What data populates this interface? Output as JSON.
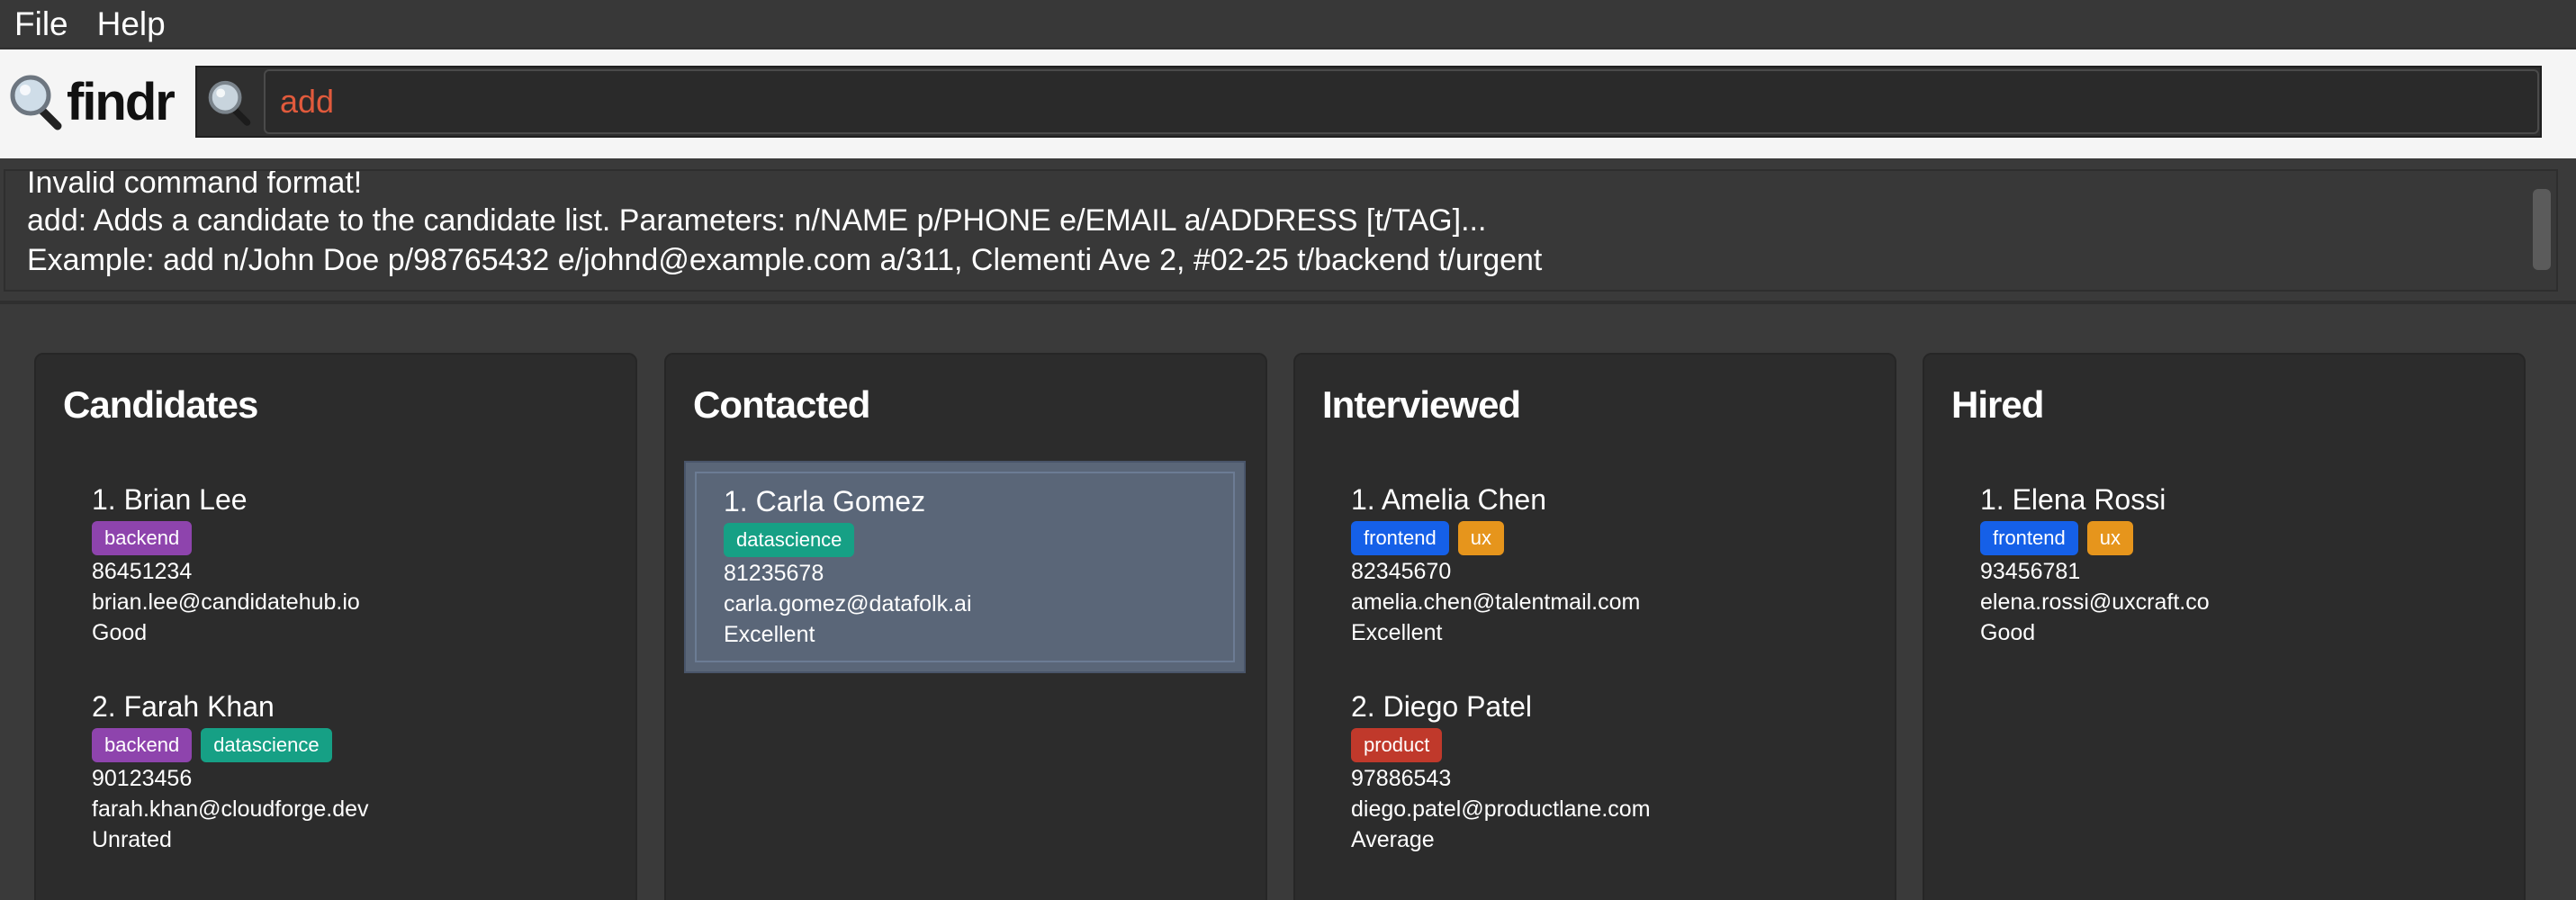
{
  "menu": {
    "file": "File",
    "help": "Help"
  },
  "header": {
    "logo_text": "findr"
  },
  "search": {
    "value": "add"
  },
  "result": {
    "lines": [
      "Invalid command format!",
      "add: Adds a candidate to the candidate list. Parameters: n/NAME p/PHONE e/EMAIL a/ADDRESS [t/TAG]...",
      "Example: add n/John Doe p/98765432 e/johnd@example.com a/311, Clementi Ave 2, #02-25 t/backend t/urgent"
    ]
  },
  "colors": {
    "backend": "#8e44ad",
    "datascience": "#16a085",
    "frontend": "#1560e8",
    "ux": "#e6951c",
    "product": "#c0392b",
    "search_text": "#e15a3c"
  },
  "columns": [
    {
      "title": "Candidates",
      "cards": [
        {
          "name": "1. Brian Lee",
          "tags": [
            {
              "label": "backend",
              "color": "#8e44ad"
            }
          ],
          "phone": "86451234",
          "email": "brian.lee@candidatehub.io",
          "rating": "Good"
        },
        {
          "name": "2. Farah Khan",
          "tags": [
            {
              "label": "backend",
              "color": "#8e44ad"
            },
            {
              "label": "datascience",
              "color": "#16a085"
            }
          ],
          "phone": "90123456",
          "email": "farah.khan@cloudforge.dev",
          "rating": "Unrated"
        }
      ]
    },
    {
      "title": "Contacted",
      "cards": [
        {
          "name": "1. Carla Gomez",
          "tags": [
            {
              "label": "datascience",
              "color": "#16a085"
            }
          ],
          "phone": "81235678",
          "email": "carla.gomez@datafolk.ai",
          "rating": "Excellent",
          "selected": true
        }
      ]
    },
    {
      "title": "Interviewed",
      "cards": [
        {
          "name": "1. Amelia Chen",
          "tags": [
            {
              "label": "frontend",
              "color": "#1560e8"
            },
            {
              "label": "ux",
              "color": "#e6951c"
            }
          ],
          "phone": "82345670",
          "email": "amelia.chen@talentmail.com",
          "rating": "Excellent"
        },
        {
          "name": "2. Diego Patel",
          "tags": [
            {
              "label": "product",
              "color": "#c0392b"
            }
          ],
          "phone": "97886543",
          "email": "diego.patel@productlane.com",
          "rating": "Average"
        }
      ]
    },
    {
      "title": "Hired",
      "cards": [
        {
          "name": "1. Elena Rossi",
          "tags": [
            {
              "label": "frontend",
              "color": "#1560e8"
            },
            {
              "label": "ux",
              "color": "#e6951c"
            }
          ],
          "phone": "93456781",
          "email": "elena.rossi@uxcraft.co",
          "rating": "Good"
        }
      ]
    }
  ]
}
